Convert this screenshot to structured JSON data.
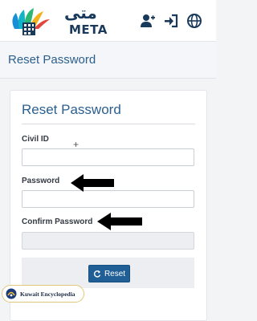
{
  "header": {
    "logo_latin": "META",
    "logo_arabic": "متى",
    "icons": [
      "add-user-icon",
      "sign-in-icon",
      "globe-icon"
    ]
  },
  "subbar": {
    "title": "Reset Password"
  },
  "form": {
    "title": "Reset Password",
    "civil_id_label": "Civil ID",
    "civil_id_value": "",
    "password_label": "Password",
    "password_value": "",
    "confirm_label": "Confirm Password",
    "confirm_value": "",
    "reset_label": "Reset"
  },
  "badge": {
    "text": "Kuwait Encyclopedia"
  },
  "colors": {
    "primary": "#1f5f96",
    "title": "#2b5f8f",
    "arrow": "#000000"
  }
}
